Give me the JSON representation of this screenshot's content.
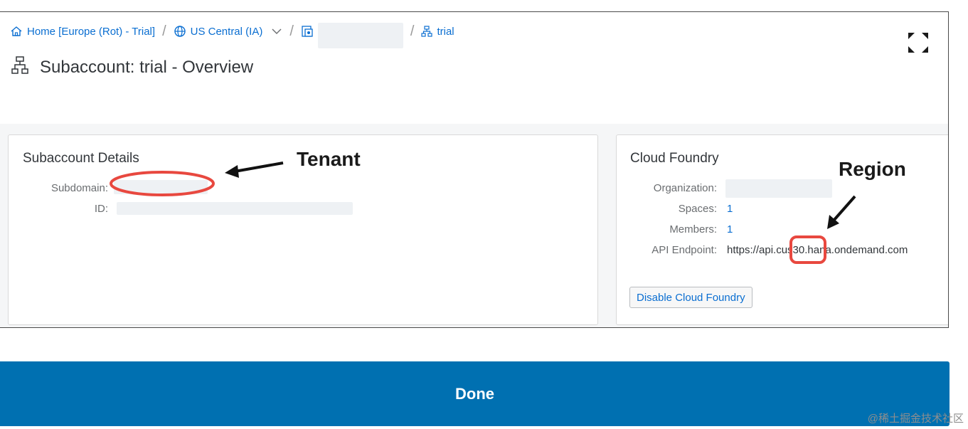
{
  "breadcrumb": {
    "home_label": "Home [Europe (Rot) - Trial]",
    "region_label": "US Central (IA)",
    "subaccount_label": "trial"
  },
  "header": {
    "title": "Subaccount: trial - Overview"
  },
  "subaccount_details": {
    "title": "Subaccount Details",
    "subdomain_label": "Subdomain:",
    "id_label": "ID:"
  },
  "cloud_foundry": {
    "title": "Cloud Foundry",
    "organization_label": "Organization:",
    "spaces_label": "Spaces:",
    "spaces_value": "1",
    "members_label": "Members:",
    "members_value": "1",
    "api_endpoint_label": "API Endpoint:",
    "api_endpoint_prefix": "https://api.c",
    "api_endpoint_region": "us30.",
    "api_endpoint_suffix": "hana.ondemand.com",
    "disable_button_label": "Disable Cloud Foundry"
  },
  "annotations": {
    "tenant": "Tenant",
    "region": "Region",
    "highlight_color": "#e8483f"
  },
  "footer": {
    "done_label": "Done"
  },
  "watermark": "@稀土掘金技术社区",
  "colors": {
    "link": "#0a6ed1",
    "primary_button": "#0070b1",
    "text": "#32363a"
  },
  "icons": {
    "home": "home-icon",
    "globe": "globe-icon",
    "chevron": "chevron-down-icon",
    "subaccount": "subaccount-hierarchy-icon",
    "directory": "directory-icon",
    "expand": "fullscreen-icon"
  }
}
